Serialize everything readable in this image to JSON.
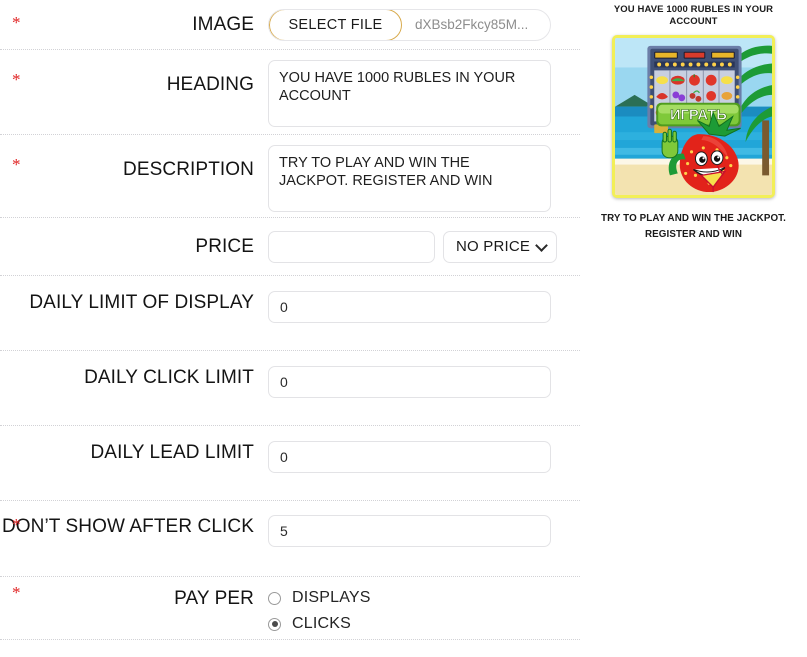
{
  "form": {
    "rows": [
      {
        "key": "image",
        "label": "IMAGE",
        "required": true,
        "type": "file",
        "button_label": "SELECT FILE",
        "file_name": "dXBsb2Fkcy85M..."
      },
      {
        "key": "heading",
        "label": "HEADING",
        "required": true,
        "type": "textarea",
        "value": "YOU HAVE 1000 RUBLES IN YOUR ACCOUNT"
      },
      {
        "key": "description",
        "label": "DESCRIPTION",
        "required": true,
        "type": "textarea",
        "value": "TRY TO PLAY AND WIN THE JACKPOT. REGISTER AND WIN"
      },
      {
        "key": "price",
        "label": "PRICE",
        "required": false,
        "type": "price",
        "value": "",
        "placeholder": "",
        "select_value": "NO PRICE",
        "select_options": [
          "NO PRICE"
        ]
      },
      {
        "key": "daily_limit_of_display",
        "label": "DAILY LIMIT OF DISPLAY",
        "required": false,
        "type": "text",
        "value": "0"
      },
      {
        "key": "daily_click_limit",
        "label": "DAILY CLICK LIMIT",
        "required": false,
        "type": "text",
        "value": "0"
      },
      {
        "key": "daily_lead_limit",
        "label": "DAILY LEAD LIMIT",
        "required": false,
        "type": "text",
        "value": "0"
      },
      {
        "key": "dont_show_after_click",
        "label": "DON’T SHOW AFTER CLICK",
        "required": true,
        "type": "text",
        "value": "5"
      },
      {
        "key": "pay_per",
        "label": "PAY PER",
        "required": true,
        "type": "radio",
        "options": [
          {
            "label": "DISPLAYS",
            "selected": false
          },
          {
            "label": "CLICKS",
            "selected": true
          }
        ]
      }
    ],
    "required_marker": "*"
  },
  "preview": {
    "heading": "YOU HAVE 1000 RUBLES IN YOUR ACCOUNT",
    "description_line1": "TRY TO PLAY AND WIN THE JACKPOT.",
    "description_line2": "REGISTER AND WIN",
    "banner": {
      "alt": "slot-machine-strawberry-banner",
      "play_button_label": "ИГРАТЬ",
      "frame_color": "#f2ef57",
      "sky_color": "#9ad7f0",
      "sea_color": "#21a6d8",
      "sand_color": "#f3e3b0",
      "palm_color": "#1d9b36",
      "strawberry_color": "#e2231a",
      "play_button_color": "#6fbf2a"
    }
  },
  "theme": {
    "accent": "#d8ab4e",
    "required_star": "#e02020",
    "border": "#e3e3e6",
    "rule": "#d2d2d6",
    "text": "#141414",
    "muted": "#8d8d8d",
    "background": "#ffffff"
  }
}
